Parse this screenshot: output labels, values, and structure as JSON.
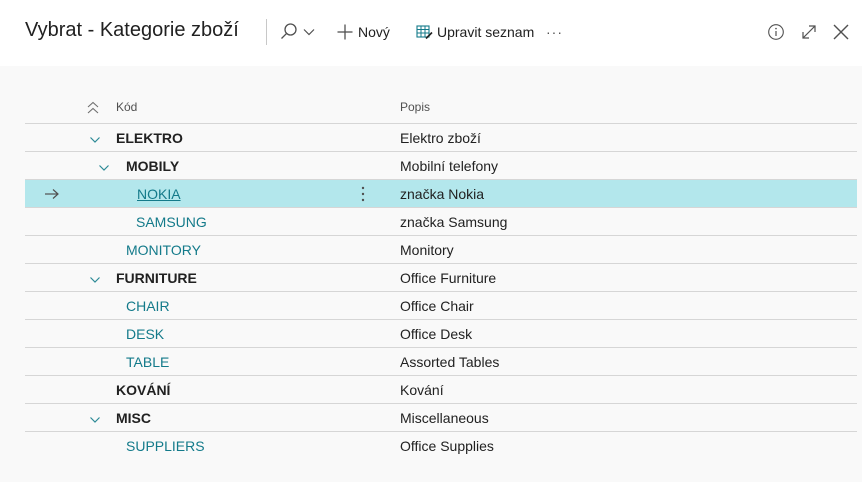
{
  "window": {
    "title": "Vybrat - Kategorie zboží"
  },
  "toolbar": {
    "new_label": "Nový",
    "edit_list_label": "Upravit seznam",
    "more_label": "···"
  },
  "columns": {
    "code": "Kód",
    "description": "Popis"
  },
  "rows": [
    {
      "code": "ELEKTRO",
      "description": "Elektro zboží"
    },
    {
      "code": "MOBILY",
      "description": "Mobilní telefony"
    },
    {
      "code": "NOKIA",
      "description": "značka Nokia"
    },
    {
      "code": "SAMSUNG",
      "description": "značka Samsung"
    },
    {
      "code": "MONITORY",
      "description": "Monitory"
    },
    {
      "code": "FURNITURE",
      "description": "Office Furniture"
    },
    {
      "code": "CHAIR",
      "description": "Office Chair"
    },
    {
      "code": "DESK",
      "description": "Office Desk"
    },
    {
      "code": "TABLE",
      "description": "Assorted Tables"
    },
    {
      "code": "KOVÁNÍ",
      "description": "Kování"
    },
    {
      "code": "MISC",
      "description": "Miscellaneous"
    },
    {
      "code": "SUPPLIERS",
      "description": "Office Supplies"
    }
  ],
  "colors": {
    "link": "#137a8a",
    "selected_row": "#b3e7ec",
    "chevron": "#2c8a96"
  }
}
